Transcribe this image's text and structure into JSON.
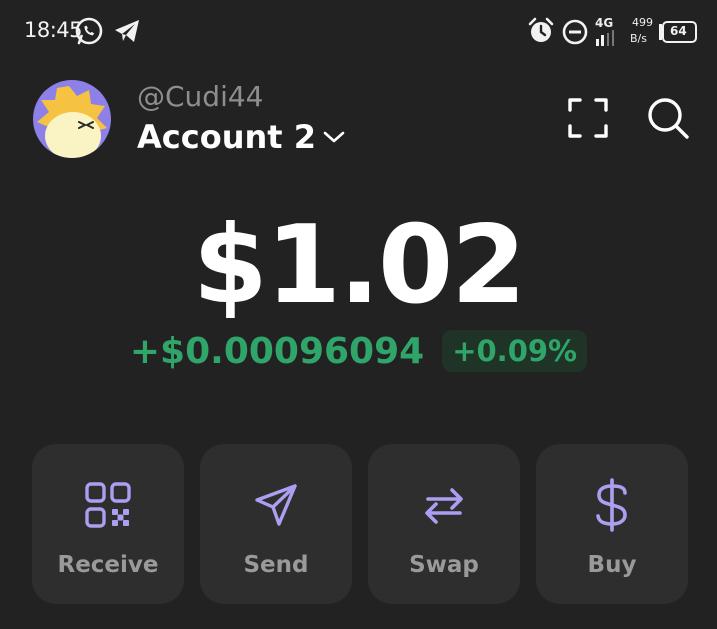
{
  "status_bar": {
    "time": "18:45",
    "network": "4G",
    "speed_top": "499",
    "speed_bottom": "B/s",
    "battery": "64"
  },
  "header": {
    "handle": "@Cudi44",
    "account_name": "Account 2"
  },
  "balance": {
    "amount": "$1.02",
    "change_value": "+$0.00096094",
    "change_percent": "+0.09%"
  },
  "actions": [
    {
      "label": "Receive",
      "icon": "qr-code-icon"
    },
    {
      "label": "Send",
      "icon": "send-icon"
    },
    {
      "label": "Swap",
      "icon": "swap-icon"
    },
    {
      "label": "Buy",
      "icon": "dollar-icon"
    }
  ],
  "colors": {
    "background": "#222222",
    "accent": "#ab9ff2",
    "positive": "#2fa56a"
  }
}
